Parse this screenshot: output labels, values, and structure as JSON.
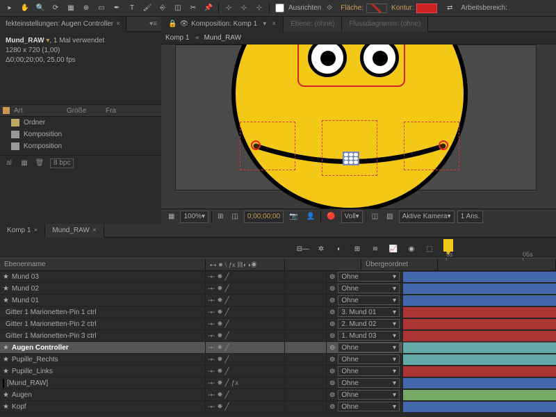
{
  "toolbar": {
    "ausrichten": "Ausrichten",
    "flaeche": "Fläche:",
    "kontur": "Kontur:",
    "arbeitsbereich": "Arbeitsbereich:"
  },
  "effectPanel": {
    "tab": "fekteinstellungen: Augen Controller",
    "asset": "Mund_RAW",
    "usage": ", 1 Mal verwendet",
    "res": "1280 x 720 (1,00)",
    "dur": "Δ0;00;20;00, 25,00 fps"
  },
  "project": {
    "col_art": "Art",
    "col_groesse": "Größe",
    "col_fra": "Fra",
    "rows": [
      {
        "type": "folder",
        "label": "Ordner"
      },
      {
        "type": "comp",
        "label": "Komposition"
      },
      {
        "type": "comp",
        "label": "Komposition"
      }
    ],
    "bottom_label": "al",
    "bpc": "8 bpc"
  },
  "compPanel": {
    "tabs": [
      {
        "label": "Komposition: Komp 1",
        "active": true
      },
      {
        "label": "Ebene: (ohne)",
        "active": false
      },
      {
        "label": "Flussdiagramm: (ohne)",
        "active": false
      }
    ],
    "crumb1": "Komp 1",
    "crumb2": "Mund_RAW",
    "zoom": "100%",
    "time": "0;00;00;00",
    "res": "Voll",
    "camera": "Aktive Kamera",
    "views": "1 Ans."
  },
  "timeline": {
    "tabs": [
      {
        "label": "Komp 1"
      },
      {
        "label": "Mund_RAW",
        "active": true
      }
    ],
    "ticks": [
      "0s",
      "05s"
    ],
    "col_name": "Ebenenname",
    "col_switch": "⬩-⬩ ✸ ⧹ ƒx 目◐◑◉",
    "col_parent": "Übergeordnet",
    "layers": [
      {
        "name": "Mund 03",
        "icon": "star",
        "parent": "Ohne",
        "color": "#4466aa"
      },
      {
        "name": "Mund 02",
        "icon": "star",
        "parent": "Ohne",
        "color": "#4466aa"
      },
      {
        "name": "Mund 01",
        "icon": "star",
        "parent": "Ohne",
        "color": "#4466aa"
      },
      {
        "name": "Gitter 1 Marionetten-Pin 1 ctrl",
        "icon": "box",
        "parent": "3. Mund 01",
        "color": "#aa3333"
      },
      {
        "name": "Gitter 1 Marionetten-Pin 2 ctrl",
        "icon": "box",
        "parent": "2. Mund 02",
        "color": "#aa3333"
      },
      {
        "name": "Gitter 1 Marionetten-Pin 3 ctrl",
        "icon": "box",
        "parent": "1. Mund 03",
        "color": "#aa3333"
      },
      {
        "name": "Augen Controller",
        "icon": "star",
        "sel": true,
        "parent": "Ohne",
        "color": "#66aaaa"
      },
      {
        "name": "Pupille_Rechts",
        "icon": "star",
        "parent": "Ohne",
        "color": "#66aaaa"
      },
      {
        "name": "Pupille_Links",
        "icon": "star",
        "parent": "Ohne",
        "color": "#aa3333"
      },
      {
        "name": "[Mund_RAW]",
        "icon": "comp",
        "fx": true,
        "parent": "Ohne",
        "color": "#4466aa"
      },
      {
        "name": "Augen",
        "icon": "star",
        "parent": "Ohne",
        "color": "#77aa66"
      },
      {
        "name": "Kopf",
        "icon": "star",
        "parent": "Ohne",
        "color": "#4466aa"
      }
    ]
  }
}
